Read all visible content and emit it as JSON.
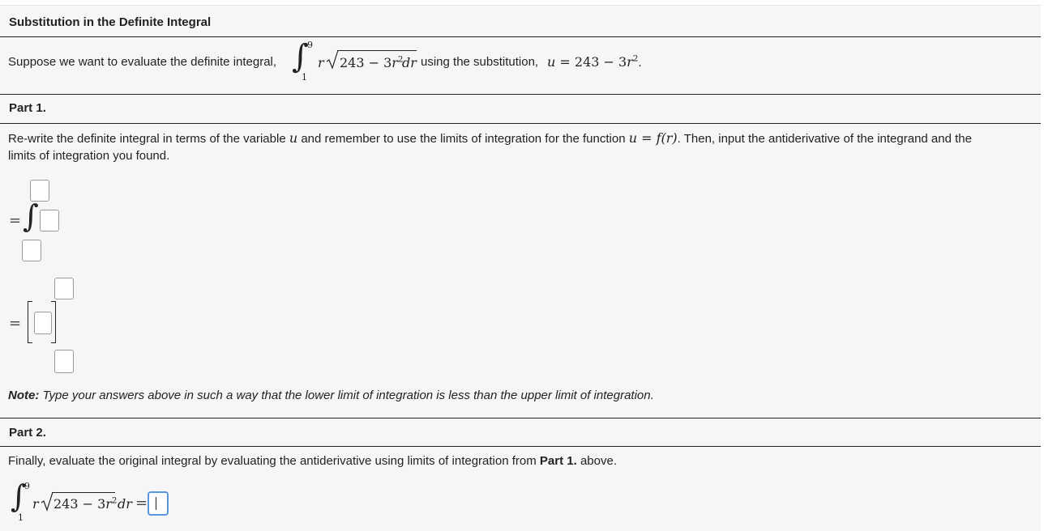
{
  "title": "Substitution in the Definite Integral",
  "intro": {
    "prefix": "Suppose we want to evaluate the definite integral,",
    "upper": "9",
    "lower": "1",
    "r": "r",
    "radicand_num": "243 − 3",
    "radicand_var": "r",
    "radicand_exp": "2",
    "dr": "dr",
    "middle": "using the substitution,",
    "sub_u": "u",
    "sub_eq": " = 243 − 3",
    "sub_r": "r",
    "sub_exp": "2",
    "end": "."
  },
  "part1": {
    "label": "Part 1.",
    "instr_1": "Re-write the definite integral in terms of the variable",
    "instr_u": "u",
    "instr_2": "and remember to use the limits of integration for the function",
    "instr_fu": "u",
    "instr_feq": " = ",
    "instr_f": "f",
    "instr_fr": "(r)",
    "instr_3": ". Then, input the antiderivative of the integrand and the",
    "instr_4": "limits of integration you found.",
    "equals": "=",
    "note_label": "Note:",
    "note_text": "Type your answers above in such a way that the lower limit of integration is less than the upper limit of integration."
  },
  "part2": {
    "label": "Part 2.",
    "instr_prefix": "Finally, evaluate the original integral by evaluating the antiderivative using limits of integration from",
    "instr_bold": "Part 1.",
    "instr_suffix": "above.",
    "upper": "9",
    "lower": "1",
    "r": "r",
    "radicand_num": "243 − 3",
    "radicand_var": "r",
    "radicand_exp": "2",
    "dr": "dr",
    "equals": "="
  }
}
